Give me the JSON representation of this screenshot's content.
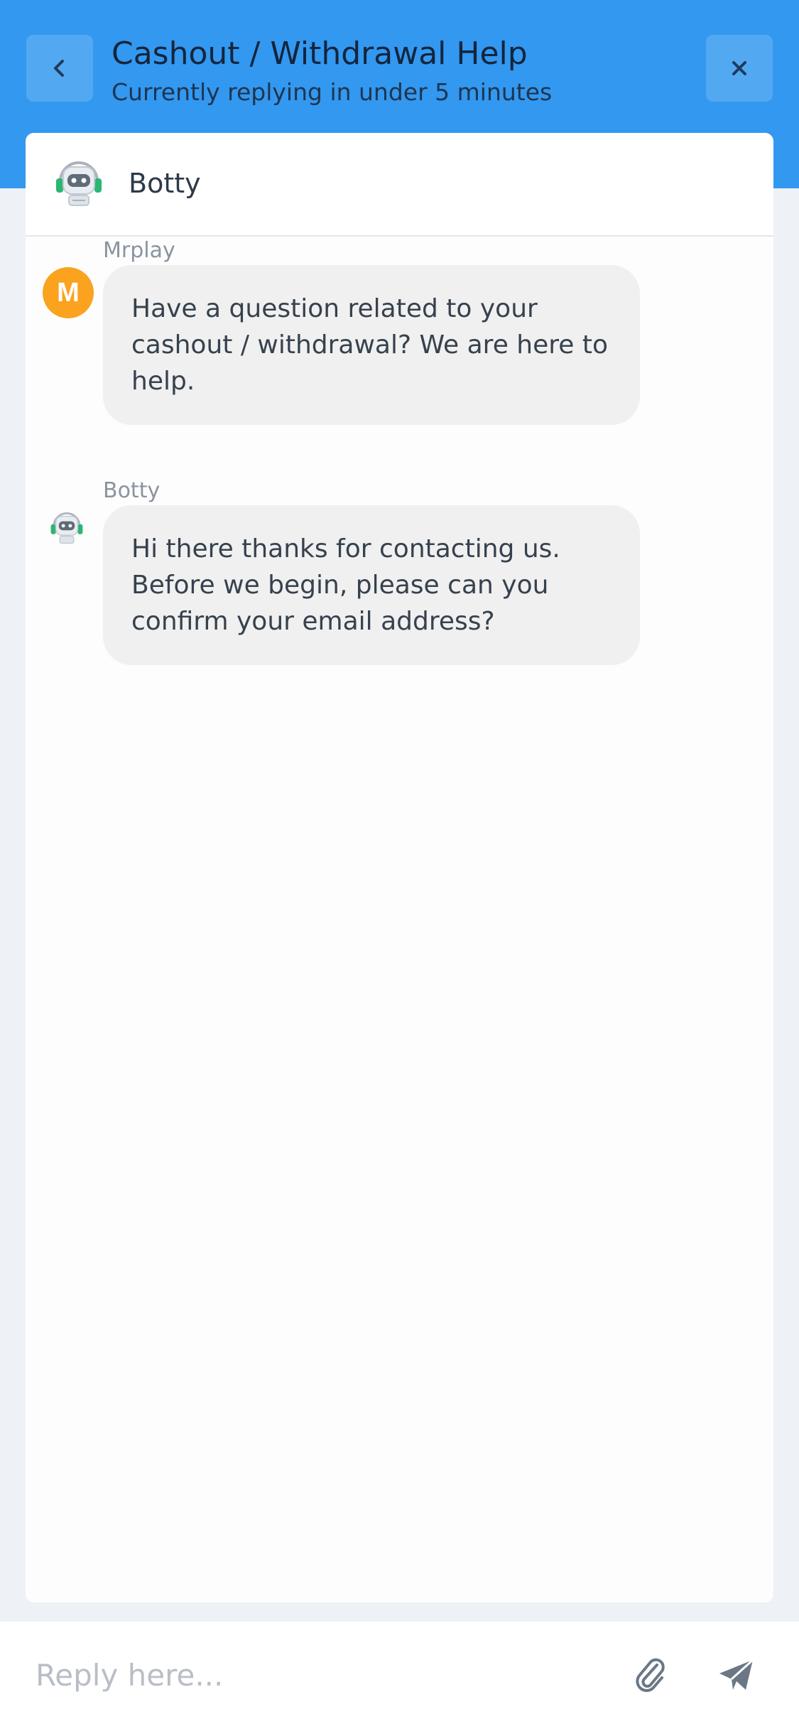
{
  "header": {
    "title": "Cashout / Withdrawal Help",
    "subtitle": "Currently replying in under 5 minutes",
    "back_icon": "chevron-left-icon",
    "close_icon": "close-icon",
    "background_color": "#3398f0"
  },
  "agent": {
    "name": "Botty",
    "avatar_icon": "robot-headset-icon"
  },
  "messages": [
    {
      "sender": "Mrplay",
      "avatar_letter": "M",
      "avatar_color": "#fba21e",
      "text": "Have a question related to your cashout / withdrawal? We are here to help."
    },
    {
      "sender": "Botty",
      "avatar_icon": "robot-headset-icon",
      "text": "Hi there thanks for contacting us. Before we begin, please can you confirm your email address?"
    }
  ],
  "reply": {
    "placeholder": "Reply here...",
    "attach_icon": "paperclip-icon",
    "send_icon": "paper-plane-icon"
  }
}
